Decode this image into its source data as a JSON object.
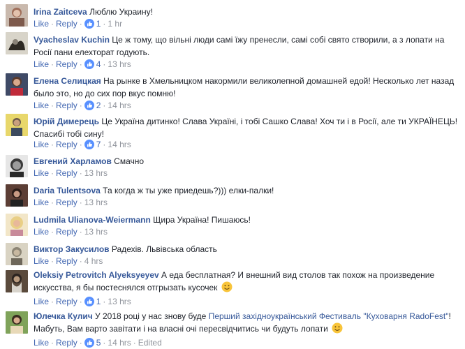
{
  "ui": {
    "like": "Like",
    "reply": "Reply",
    "sep": "·"
  },
  "comments": [
    {
      "name": "Irina Zaitceva",
      "text": "Люблю Украину!",
      "likes": "1",
      "time": "1 hr",
      "edited": ""
    },
    {
      "name": "Vyacheslav Kuchin",
      "text": "Це ж тому, що вільні люди самі їжу пренесли, самі собі свято створили, а з лопати на Росії пани елехторат годують.",
      "likes": "4",
      "time": "13 hrs",
      "edited": ""
    },
    {
      "name": "Елена Селицкая",
      "text": "На рынке в Хмельницком накормили великолепной домашней едой! Несколько лет назад было это, но до сих пор вкус помню!",
      "likes": "2",
      "time": "14 hrs",
      "edited": ""
    },
    {
      "name": "Юрій Димерець",
      "text": "Це Україна дитинко! Слава Україні, і тобі Сашко Слава! Хоч ти і в Росії, але ти УКРАЇНЕЦЬ! Спасибі тобі сину!",
      "likes": "7",
      "time": "14 hrs",
      "edited": ""
    },
    {
      "name": "Евгений Харламов",
      "text": "Смачно",
      "likes": "",
      "time": "13 hrs",
      "edited": ""
    },
    {
      "name": "Daria Tulentsova",
      "text": "Та когда ж ты уже приедешь?))) елки-палки!",
      "likes": "",
      "time": "13 hrs",
      "edited": ""
    },
    {
      "name": "Ludmila Ulianova-Weiermann",
      "text": "Щира Україна! Пишаюсь!",
      "likes": "",
      "time": "13 hrs",
      "edited": ""
    },
    {
      "name": "Виктор Закусилов",
      "text": "Радехів. Львівська область",
      "likes": "",
      "time": "4 hrs",
      "edited": ""
    },
    {
      "name": "Oleksiy Petrovitch Alyeksyeyev",
      "text": "А еда бесплатная? И внешний вид столов так похож на произведение искусства, я бы постеснялся отгрызать кусочек",
      "likes": "1",
      "time": "13 hrs",
      "edited": "",
      "emoji": "smile"
    },
    {
      "name": "Юлечка Кулич",
      "text_before": "У 2018 році у нас знову буде",
      "link": "Перший західноукраїнський Фестиваль \"Куховарня RadoFest\"",
      "text_after": "! Мабуть, Вам варто завітати і на власні очі пересвідчитись чи будуть лопати",
      "likes": "5",
      "time": "14 hrs",
      "edited": "Edited",
      "emoji": "smile"
    }
  ],
  "colors": {
    "name": "#365899",
    "action": "#4267b2",
    "meta": "#90949c",
    "text": "#1d2129",
    "like_badge": "#5890ff"
  }
}
